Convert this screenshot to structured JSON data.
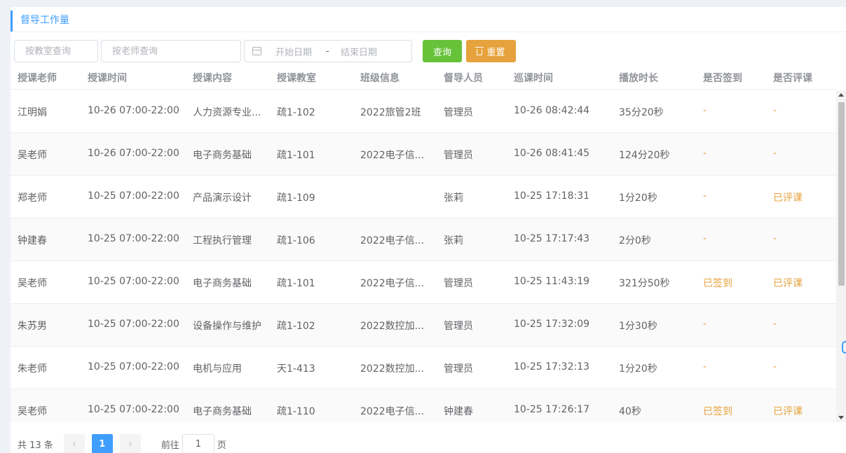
{
  "header": {
    "title": "督导工作量"
  },
  "filters": {
    "room_placeholder": "按教室查询",
    "teacher_placeholder": "按老师查询",
    "date_start_placeholder": "开始日期",
    "date_separator": "-",
    "date_end_placeholder": "结束日期",
    "query_label": "查询",
    "reset_label": "重置"
  },
  "table": {
    "columns": [
      "授课老师",
      "授课时间",
      "授课内容",
      "授课教室",
      "班级信息",
      "督导人员",
      "巡课时间",
      "播放时长",
      "是否签到",
      "是否评课"
    ],
    "rows": [
      [
        "江明娟",
        "10-26 07:00-22:00",
        "人力资源专业...",
        "疏1-102",
        "2022旅管2班",
        "管理员",
        "10-26 08:42:44",
        "35分20秒",
        "-",
        "-"
      ],
      [
        "吴老师",
        "10-26 07:00-22:00",
        "电子商务基础",
        "疏1-101",
        "2022电子信...",
        "管理员",
        "10-26 08:41:45",
        "124分20秒",
        "-",
        "-"
      ],
      [
        "郑老师",
        "10-25 07:00-22:00",
        "产品演示设计",
        "疏1-109",
        "",
        "张莉",
        "10-25 17:18:31",
        "1分20秒",
        "-",
        "已评课"
      ],
      [
        "钟建春",
        "10-25 07:00-22:00",
        "工程执行管理",
        "疏1-106",
        "2022电子信...",
        "张莉",
        "10-25 17:17:43",
        "2分0秒",
        "-",
        "-"
      ],
      [
        "吴老师",
        "10-25 07:00-22:00",
        "电子商务基础",
        "疏1-101",
        "2022电子信...",
        "管理员",
        "10-25 11:43:19",
        "321分50秒",
        "已签到",
        "已评课"
      ],
      [
        "朱苏男",
        "10-25 07:00-22:00",
        "设备操作与维护",
        "疏1-102",
        "2022数控加...",
        "管理员",
        "10-25 17:32:09",
        "1分30秒",
        "-",
        "-"
      ],
      [
        "朱老师",
        "10-25 07:00-22:00",
        "电机与应用",
        "天1-413",
        "2022数控加...",
        "管理员",
        "10-25 17:32:13",
        "1分20秒",
        "-",
        "-"
      ],
      [
        "吴老师",
        "10-25 07:00-22:00",
        "电子商务基础",
        "疏1-110",
        "2022电子信...",
        "钟建春",
        "10-25 17:26:17",
        "40秒",
        "已签到",
        "已评课"
      ]
    ]
  },
  "pagination": {
    "total_text": "共 13 条",
    "prev_icon": "‹",
    "current_page": "1",
    "next_icon": "›",
    "goto_label": "前往",
    "goto_value": "1",
    "page_unit": "页"
  },
  "colors": {
    "accent": "#409eff",
    "success": "#67c23a",
    "warning": "#e6a23c"
  }
}
